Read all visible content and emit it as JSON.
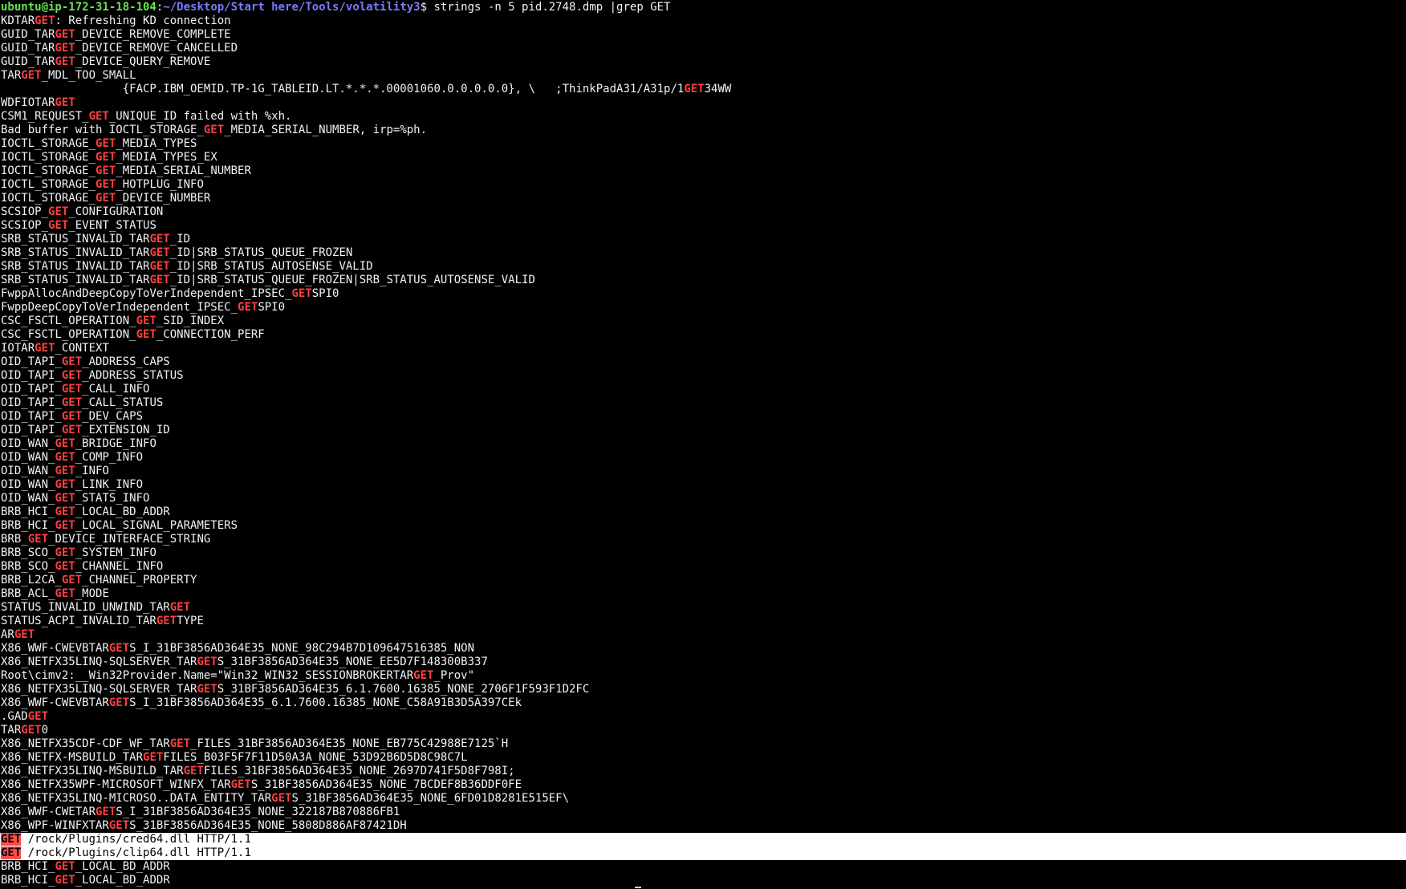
{
  "prompt": {
    "user_host": "ubuntu@ip-172-31-18-104",
    "separator": ":",
    "path": "~/Desktop/Start here/Tools/volatility3",
    "symbol": "$ ",
    "command": "strings -n 5 pid.2748.dmp |grep GET"
  },
  "colors": {
    "background": "#000000",
    "text": "#f2f2f2",
    "prompt_user": "#67e34e",
    "prompt_path": "#7b7bff",
    "match": "#ff3f3f",
    "selection_background": "#ffffff"
  },
  "output_lines": [
    {
      "pre": "KDTAR",
      "match": "GET",
      "post": ": Refreshing KD connection"
    },
    {
      "pre": "GUID_TAR",
      "match": "GET",
      "post": "_DEVICE_REMOVE_COMPLETE"
    },
    {
      "pre": "GUID_TAR",
      "match": "GET",
      "post": "_DEVICE_REMOVE_CANCELLED"
    },
    {
      "pre": "GUID_TAR",
      "match": "GET",
      "post": "_DEVICE_QUERY_REMOVE"
    },
    {
      "pre": "TAR",
      "match": "GET",
      "post": "_MDL_TOO_SMALL"
    },
    {
      "pre": "                  {FACP.IBM_OEMID.TP-1G_TABLEID.LT.*.*.*.00001060.0.0.0.0.0}, \\   ;ThinkPadA31/A31p/1",
      "match": "GET",
      "post": "34WW"
    },
    {
      "pre": "WDFIOTAR",
      "match": "GET",
      "post": ""
    },
    {
      "pre": "CSM1_REQUEST_",
      "match": "GET",
      "post": "_UNIQUE_ID failed with %xh."
    },
    {
      "pre": "Bad buffer with IOCTL_STORAGE_",
      "match": "GET",
      "post": "_MEDIA_SERIAL_NUMBER, irp=%ph."
    },
    {
      "pre": "IOCTL_STORAGE_",
      "match": "GET",
      "post": "_MEDIA_TYPES"
    },
    {
      "pre": "IOCTL_STORAGE_",
      "match": "GET",
      "post": "_MEDIA_TYPES_EX"
    },
    {
      "pre": "IOCTL_STORAGE_",
      "match": "GET",
      "post": "_MEDIA_SERIAL_NUMBER"
    },
    {
      "pre": "IOCTL_STORAGE_",
      "match": "GET",
      "post": "_HOTPLUG_INFO"
    },
    {
      "pre": "IOCTL_STORAGE_",
      "match": "GET",
      "post": "_DEVICE_NUMBER"
    },
    {
      "pre": "SCSIOP_",
      "match": "GET",
      "post": "_CONFIGURATION"
    },
    {
      "pre": "SCSIOP_",
      "match": "GET",
      "post": "_EVENT_STATUS"
    },
    {
      "pre": "SRB_STATUS_INVALID_TAR",
      "match": "GET",
      "post": "_ID"
    },
    {
      "pre": "SRB_STATUS_INVALID_TAR",
      "match": "GET",
      "post": "_ID|SRB_STATUS_QUEUE_FROZEN"
    },
    {
      "pre": "SRB_STATUS_INVALID_TAR",
      "match": "GET",
      "post": "_ID|SRB_STATUS_AUTOSENSE_VALID"
    },
    {
      "pre": "SRB_STATUS_INVALID_TAR",
      "match": "GET",
      "post": "_ID|SRB_STATUS_QUEUE_FROZEN|SRB_STATUS_AUTOSENSE_VALID"
    },
    {
      "pre": "FwppAllocAndDeepCopyToVerIndependent_IPSEC_",
      "match": "GET",
      "post": "SPI0"
    },
    {
      "pre": "FwppDeepCopyToVerIndependent_IPSEC_",
      "match": "GET",
      "post": "SPI0"
    },
    {
      "pre": "CSC_FSCTL_OPERATION_",
      "match": "GET",
      "post": "_SID_INDEX"
    },
    {
      "pre": "CSC_FSCTL_OPERATION_",
      "match": "GET",
      "post": "_CONNECTION_PERF"
    },
    {
      "pre": "IOTAR",
      "match": "GET",
      "post": "_CONTEXT"
    },
    {
      "pre": "OID_TAPI_",
      "match": "GET",
      "post": "_ADDRESS_CAPS"
    },
    {
      "pre": "OID_TAPI_",
      "match": "GET",
      "post": "_ADDRESS_STATUS"
    },
    {
      "pre": "OID_TAPI_",
      "match": "GET",
      "post": "_CALL_INFO"
    },
    {
      "pre": "OID_TAPI_",
      "match": "GET",
      "post": "_CALL_STATUS"
    },
    {
      "pre": "OID_TAPI_",
      "match": "GET",
      "post": "_DEV_CAPS"
    },
    {
      "pre": "OID_TAPI_",
      "match": "GET",
      "post": "_EXTENSION_ID"
    },
    {
      "pre": "OID_WAN_",
      "match": "GET",
      "post": "_BRIDGE_INFO"
    },
    {
      "pre": "OID_WAN_",
      "match": "GET",
      "post": "_COMP_INFO"
    },
    {
      "pre": "OID_WAN_",
      "match": "GET",
      "post": "_INFO"
    },
    {
      "pre": "OID_WAN_",
      "match": "GET",
      "post": "_LINK_INFO"
    },
    {
      "pre": "OID_WAN_",
      "match": "GET",
      "post": "_STATS_INFO"
    },
    {
      "pre": "BRB_HCI_",
      "match": "GET",
      "post": "_LOCAL_BD_ADDR"
    },
    {
      "pre": "BRB_HCI_",
      "match": "GET",
      "post": "_LOCAL_SIGNAL_PARAMETERS"
    },
    {
      "pre": "BRB_",
      "match": "GET",
      "post": "_DEVICE_INTERFACE_STRING"
    },
    {
      "pre": "BRB_SCO_",
      "match": "GET",
      "post": "_SYSTEM_INFO"
    },
    {
      "pre": "BRB_SCO_",
      "match": "GET",
      "post": "_CHANNEL_INFO"
    },
    {
      "pre": "BRB_L2CA_",
      "match": "GET",
      "post": "_CHANNEL_PROPERTY"
    },
    {
      "pre": "BRB_ACL_",
      "match": "GET",
      "post": "_MODE"
    },
    {
      "pre": "STATUS_INVALID_UNWIND_TAR",
      "match": "GET",
      "post": ""
    },
    {
      "pre": "STATUS_ACPI_INVALID_TAR",
      "match": "GET",
      "post": "TYPE"
    },
    {
      "pre": "AR",
      "match": "GET",
      "post": ""
    },
    {
      "pre": "X86_WWF-CWEVBTAR",
      "match": "GET",
      "post": "S_I_31BF3856AD364E35_NONE_98C294B7D109647516385_NON"
    },
    {
      "pre": "X86_NETFX35LINQ-SQLSERVER_TAR",
      "match": "GET",
      "post": "S_31BF3856AD364E35_NONE_EE5D7F148300B337"
    },
    {
      "pre": "Root\\cimv2:__Win32Provider.Name=\"Win32_WIN32_SESSIONBROKERTAR",
      "match": "GET",
      "post": "_Prov\""
    },
    {
      "pre": "X86_NETFX35LINQ-SQLSERVER_TAR",
      "match": "GET",
      "post": "S_31BF3856AD364E35_6.1.7600.16385_NONE_2706F1F593F1D2FC"
    },
    {
      "pre": "X86_WWF-CWEVBTAR",
      "match": "GET",
      "post": "S_I_31BF3856AD364E35_6.1.7600.16385_NONE_C58A91B3D5A397CEk"
    },
    {
      "pre": ".GAD",
      "match": "GET",
      "post": ""
    },
    {
      "pre": "TAR",
      "match": "GET",
      "post": "0"
    },
    {
      "pre": "X86_NETFX35CDF-CDF_WF_TAR",
      "match": "GET",
      "post": "_FILES_31BF3856AD364E35_NONE_EB775C42988E7125`H"
    },
    {
      "pre": "X86_NETFX-MSBUILD_TAR",
      "match": "GET",
      "post": "FILES_B03F5F7F11D50A3A_NONE_53D92B6D5D8C98C7L"
    },
    {
      "pre": "X86_NETFX35LINQ-MSBUILD_TAR",
      "match": "GET",
      "post": "FILES_31BF3856AD364E35_NONE_2697D741F5D8F798I;"
    },
    {
      "pre": "X86_NETFX35WPF-MICROSOFT_WINFX_TAR",
      "match": "GET",
      "post": "S_31BF3856AD364E35_NONE_7BCDEF8B36DDF0FE"
    },
    {
      "pre": "X86_NETFX35LINQ-MICROSO..DATA_ENTITY_TAR",
      "match": "GET",
      "post": "S_31BF3856AD364E35_NONE_6FD01D8281E515EF\\"
    },
    {
      "pre": "X86_WWF-CWETAR",
      "match": "GET",
      "post": "S_I_31BF3856AD364E35_NONE_322187B870886FB1"
    },
    {
      "pre": "X86_WPF-WINFXTAR",
      "match": "GET",
      "post": "S_31BF3856AD364E35_NONE_5808D886AF87421DH"
    },
    {
      "pre": "",
      "match": "GET",
      "post": " /rock/Plugins/cred64.dll HTTP/1.1",
      "highlighted": true
    },
    {
      "pre": "",
      "match": "GET",
      "post": " /rock/Plugins/clip64.dll HTTP/1.1",
      "highlighted": true
    },
    {
      "pre": "BRB_HCI_",
      "match": "GET",
      "post": "_LOCAL_BD_ADDR"
    },
    {
      "pre": "BRB_HCI_",
      "match": "GET",
      "post": "_LOCAL_BD_ADDR"
    }
  ]
}
